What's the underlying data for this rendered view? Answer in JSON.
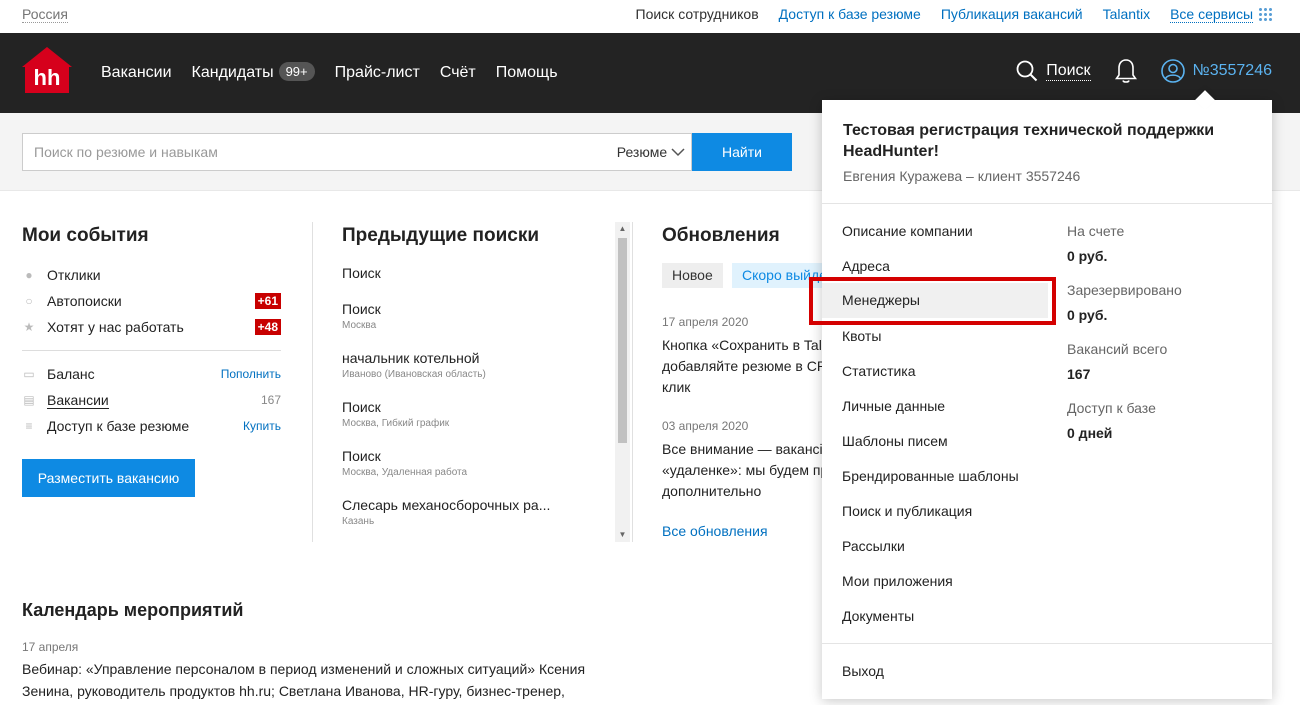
{
  "topbar": {
    "region": "Россия",
    "links": [
      "Поиск сотрудников",
      "Доступ к базе резюме",
      "Публикация вакансий",
      "Talantix",
      "Все сервисы"
    ]
  },
  "header": {
    "logo_text": "hh",
    "nav": [
      "Вакансии",
      "Кандидаты",
      "Прайс-лист",
      "Счёт",
      "Помощь"
    ],
    "candidates_badge": "99+",
    "search_label": "Поиск",
    "account": "№3557246"
  },
  "search": {
    "placeholder": "Поиск по резюме и навыкам",
    "type": "Резюме",
    "button": "Найти"
  },
  "events": {
    "title": "Мои события",
    "items": [
      {
        "label": "Отклики"
      },
      {
        "label": "Автопоиски",
        "badge": "+61"
      },
      {
        "label": "Хотят у нас работать",
        "badge": "+48"
      }
    ],
    "balance": {
      "label": "Баланс",
      "action": "Пополнить"
    },
    "vacancies": {
      "label": "Вакансии",
      "count": "167"
    },
    "access": {
      "label": "Доступ к базе резюме",
      "action": "Купить"
    },
    "post_button": "Разместить вакансию"
  },
  "prev_searches": {
    "title": "Предыдущие поиски",
    "items": [
      {
        "title": "Поиск",
        "sub": ""
      },
      {
        "title": "Поиск",
        "sub": "Москва"
      },
      {
        "title": "начальник котельной",
        "sub": "Иваново (Ивановская область)"
      },
      {
        "title": "Поиск",
        "sub": "Москва, Гибкий график"
      },
      {
        "title": "Поиск",
        "sub": "Москва, Удаленная работа"
      },
      {
        "title": "Слесарь механосборочных ра...",
        "sub": "Казань"
      }
    ]
  },
  "updates": {
    "title": "Обновления",
    "tabs": [
      "Новое",
      "Скоро выйдет"
    ],
    "items": [
      {
        "date": "17 апреля 2020",
        "lines": [
          "Кнопка «Сохранить в Tal",
          "добавляйте резюме в CR",
          "клик"
        ]
      },
      {
        "date": "03 апреля 2020",
        "lines": [
          "Все внимание — вакансі",
          "«удаленке»: мы будем пр",
          "дополнительно"
        ]
      }
    ],
    "all_link": "Все обновления"
  },
  "calendar": {
    "title": "Календарь мероприятий",
    "date": "17 апреля",
    "text": "Вебинар: «Управление персоналом в период изменений и сложных ситуаций» Ксения Зенина, руководитель продуктов hh.ru; Светлана Иванова, HR-гуру, бизнес-тренер,"
  },
  "dropdown": {
    "org": "Тестовая регистрация технической поддержки HeadHunter!",
    "who": "Евгения Куражева – клиент 3557246",
    "menu": [
      "Описание компании",
      "Адреса",
      "Менеджеры",
      "Квоты",
      "Статистика",
      "Личные данные",
      "Шаблоны писем",
      "Брендированные шаблоны",
      "Поиск и публикация",
      "Рассылки",
      "Мои приложения",
      "Документы"
    ],
    "logout": "Выход",
    "stats": [
      {
        "label": "На счете",
        "value": "0 руб."
      },
      {
        "label": "Зарезервировано",
        "value": "0 руб."
      },
      {
        "label": "Вакансий всего",
        "value": "167"
      },
      {
        "label": "Доступ к базе",
        "value": "0 дней"
      }
    ]
  },
  "colors": {
    "accent": "#0e8ae3",
    "header_bg": "#232323",
    "logo_red": "#d6001c",
    "badge_red": "#c80000"
  }
}
